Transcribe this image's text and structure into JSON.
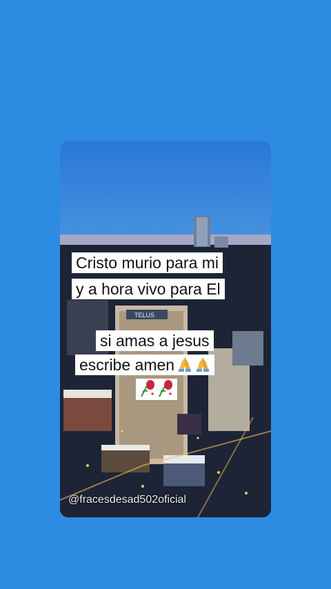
{
  "background_color": "#2e8be2",
  "post": {
    "line1": "Cristo murio para mi",
    "line2": "y a hora vivo para El",
    "line3": "si amas a jesus",
    "line4": "escribe amen",
    "line4_emoji": "folded-hands-icon",
    "line5_emoji": "wilted-rose-icon",
    "watermark": "@fracesdesad502oficial"
  }
}
